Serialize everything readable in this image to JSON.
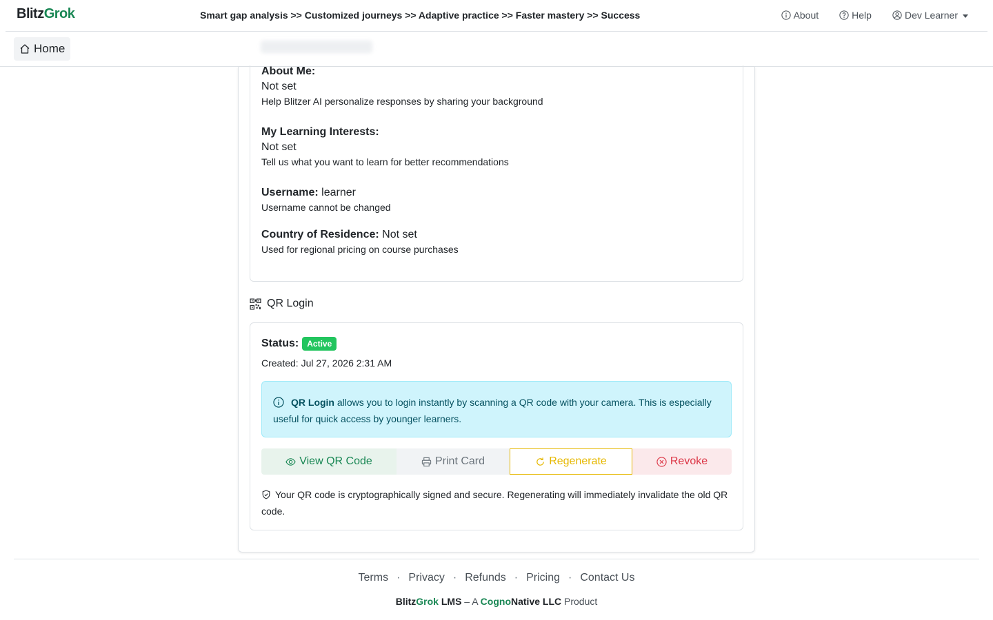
{
  "header": {
    "brand_part1": "Blitz",
    "brand_part2": "Grok",
    "tagline": "Smart gap analysis >> Customized journeys >> Adaptive practice >> Faster mastery >> Success",
    "about_label": "About",
    "help_label": "Help",
    "user_label": "Dev Learner"
  },
  "subnav": {
    "home_label": "Home"
  },
  "profile": {
    "about_me": {
      "label": "About Me:",
      "value": "Not set",
      "hint": "Help Blitzer AI personalize responses by sharing your background"
    },
    "interests": {
      "label": "My Learning Interests:",
      "value": "Not set",
      "hint": "Tell us what you want to learn for better recommendations"
    },
    "username": {
      "label": "Username:",
      "value": "learner",
      "hint": "Username cannot be changed"
    },
    "country": {
      "label": "Country of Residence:",
      "value": "Not set",
      "hint": "Used for regional pricing on course purchases"
    }
  },
  "qr": {
    "heading": "QR Login",
    "status_label": "Status:",
    "status_value": "Active",
    "created": "Created: Jul 27, 2026 2:31 AM",
    "info_strong": "QR Login",
    "info_text": " allows you to login instantly by scanning a QR code with your camera. This is especially useful for quick access by younger learners.",
    "buttons": {
      "view": "View QR Code",
      "print": "Print Card",
      "regenerate": "Regenerate",
      "revoke": "Revoke"
    },
    "secure_note": "Your QR code is cryptographically signed and secure. Regenerating will immediately invalidate the old QR code."
  },
  "footer": {
    "links": [
      "Terms",
      "Privacy",
      "Refunds",
      "Pricing",
      "Contact Us"
    ],
    "separator": "·",
    "brand_blitz": "Blitz",
    "brand_grok": "Grok",
    "brand_lms": " LMS",
    "brand_dash": " – A ",
    "brand_cogno": "Cogno",
    "brand_native": "Native LLC",
    "brand_product": " Product"
  },
  "colors": {
    "brand_green": "#198754",
    "badge_green": "#22c55e",
    "info_bg": "#cff4fc",
    "warning": "#e6b800",
    "danger": "#dc3545"
  }
}
